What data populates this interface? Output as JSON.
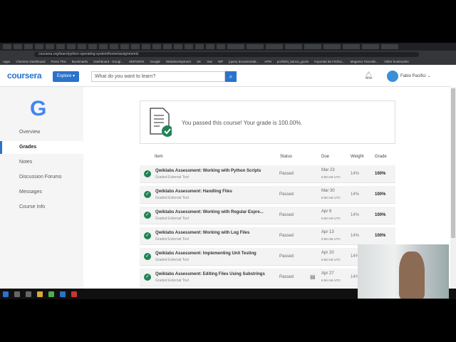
{
  "browser": {
    "url": "coursera.org/learn/python-operating-system/home/assignments",
    "bookmarks": [
      "Apps",
      "Chemistr Dashboard",
      "Press This",
      "Bookmarks",
      "Dashboard - Googl...",
      "SERVERS",
      "Google",
      "Webdevelopment",
      "UK",
      "Vue",
      "WP",
      "jquery documentati...",
      "APM",
      "profiloht_banca_goolo",
      "Importati da Firefox...",
      "Magento Tutorials...",
      "Other bookmarks"
    ]
  },
  "header": {
    "logo": "coursera",
    "explore": "Explore ▾",
    "search_placeholder": "What do you want to learn?",
    "user": "Fabio Pacifici ⌄"
  },
  "sidebar": {
    "logo": "G",
    "items": [
      {
        "label": "Overview"
      },
      {
        "label": "Grades"
      },
      {
        "label": "Notes"
      },
      {
        "label": "Discussion Forums"
      },
      {
        "label": "Messages"
      },
      {
        "label": "Course Info"
      }
    ]
  },
  "summary": "You passed this course! Your grade is 100.00%.",
  "table": {
    "headers": {
      "item": "Item",
      "status": "Status",
      "due": "Due",
      "weight": "Weight",
      "grade": "Grade"
    },
    "rows": [
      {
        "title": "Qwiklabs Assessment: Working with Python Scripts",
        "type": "Graded External Tool",
        "status": "Passed",
        "due": "Mar 23",
        "time": "6:59 AM UTC",
        "weight": "14%",
        "grade": "100%"
      },
      {
        "title": "Qwiklabs Assessment: Handling Files",
        "type": "Graded External Tool",
        "status": "Passed",
        "due": "Mar 30",
        "time": "6:59 AM UTC",
        "weight": "14%",
        "grade": "100%"
      },
      {
        "title": "Qwiklabs Assessment: Working with Regular Expre...",
        "type": "Graded External Tool",
        "status": "Passed",
        "due": "Apr 6",
        "time": "6:59 AM UTC",
        "weight": "14%",
        "grade": "100%"
      },
      {
        "title": "Qwiklabs Assessment: Working with Log Files",
        "type": "Graded External Tool",
        "status": "Passed",
        "due": "Apr 13",
        "time": "6:59 AM UTC",
        "weight": "14%",
        "grade": "100%"
      },
      {
        "title": "Qwiklabs Assessment: Implementing Unit Testing",
        "type": "Graded External Tool",
        "status": "Passed",
        "due": "Apr 20",
        "time": "6:59 AM UTC",
        "weight": "14%",
        "grade": ""
      },
      {
        "title": "Qwiklabs Assessment: Editing Files Using Substrings",
        "type": "Graded External Tool",
        "status": "Passed",
        "due": "Apr 27",
        "time": "6:59 AM UTC",
        "weight": "14%",
        "grade": ""
      }
    ]
  }
}
